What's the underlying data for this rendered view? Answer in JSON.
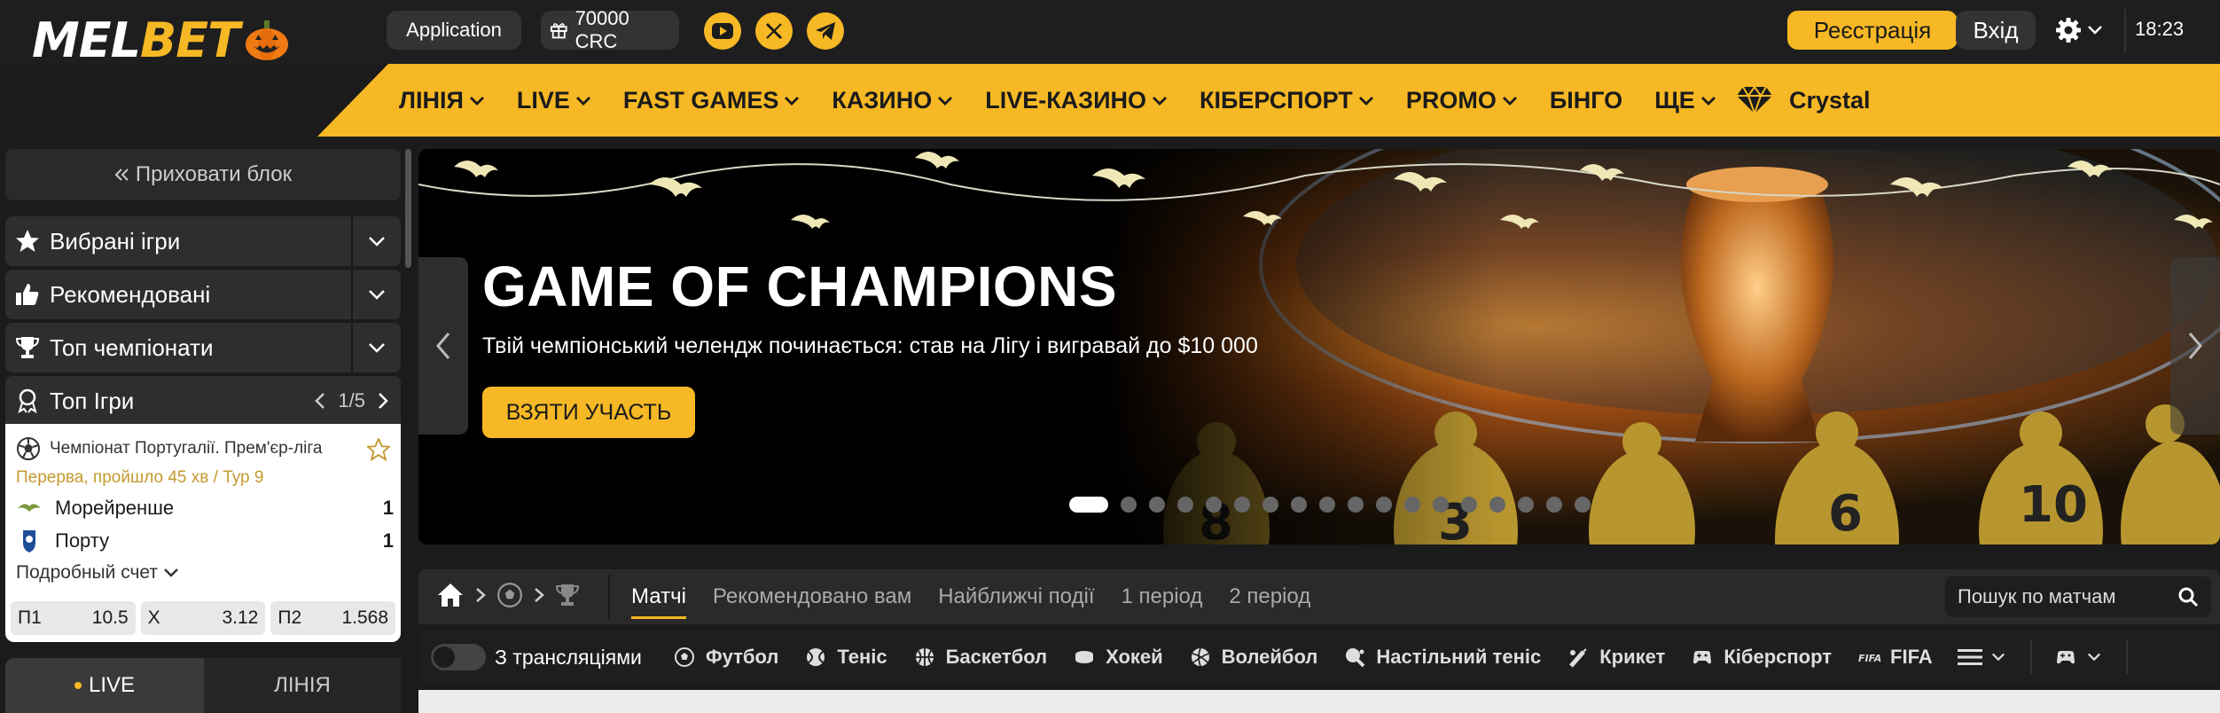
{
  "header": {
    "logo": {
      "part1": "MEL",
      "part2": "BET"
    },
    "application_label": "Application",
    "bonus_label": "70000 CRC",
    "register_label": "Реєстрація",
    "login_label": "Вхід",
    "time": "18:23"
  },
  "nav": {
    "items": [
      {
        "label": "ЛІНІЯ",
        "dropdown": true
      },
      {
        "label": "LIVE",
        "dropdown": true
      },
      {
        "label": "FAST GAMES",
        "dropdown": true
      },
      {
        "label": "КАЗИНО",
        "dropdown": true
      },
      {
        "label": "LIVE-КАЗИНО",
        "dropdown": true
      },
      {
        "label": "КІБЕРСПОРТ",
        "dropdown": true
      },
      {
        "label": "PROMO",
        "dropdown": true
      },
      {
        "label": "БІНГО",
        "dropdown": false
      },
      {
        "label": "ЩЕ",
        "dropdown": true
      }
    ],
    "crystal_label": "Crystal"
  },
  "sidebar": {
    "hide_block_label": "Приховати блок",
    "sections": [
      {
        "label": "Вибрані ігри",
        "icon": "star-icon"
      },
      {
        "label": "Рекомендовані",
        "icon": "thumbs-up-icon"
      },
      {
        "label": "Топ чемпіонати",
        "icon": "trophy-icon"
      }
    ],
    "top_games": {
      "label": "Топ Ігри",
      "page": "1/5"
    },
    "match": {
      "league": "Чемпіонат Португалії. Прем'єр-ліга",
      "status": "Перерва, пройшло 45 хв / Тур 9",
      "team1": {
        "name": "Морейренше",
        "score": "1"
      },
      "team2": {
        "name": "Порту",
        "score": "1"
      },
      "details_label": "Подробный счет",
      "odds": [
        {
          "label": "П1",
          "value": "10.5"
        },
        {
          "label": "X",
          "value": "3.12"
        },
        {
          "label": "П2",
          "value": "1.568"
        }
      ]
    },
    "tabs": {
      "live": "LIVE",
      "line": "ЛІНІЯ"
    }
  },
  "banner": {
    "title": "GAME OF CHAMPIONS",
    "subtitle": "Твій чемпіонський челендж починається: став на Лігу і вигравай до $10 000",
    "cta": "ВЗЯТИ УЧАСТЬ",
    "slide_count": 18,
    "active_slide": 1
  },
  "filters": {
    "tabs": [
      {
        "label": "Матчі",
        "active": true
      },
      {
        "label": "Рекомендовано вам",
        "active": false
      },
      {
        "label": "Найближчі події",
        "active": false
      },
      {
        "label": "1 період",
        "active": false
      },
      {
        "label": "2 період",
        "active": false
      }
    ],
    "search_placeholder": "Пошук по матчам"
  },
  "sports": {
    "toggle_label": "З трансляціями",
    "items": [
      {
        "label": "Футбол",
        "icon": "football-icon"
      },
      {
        "label": "Теніс",
        "icon": "tennis-icon"
      },
      {
        "label": "Баскетбол",
        "icon": "basketball-icon"
      },
      {
        "label": "Хокей",
        "icon": "hockey-icon"
      },
      {
        "label": "Волейбол",
        "icon": "volleyball-icon"
      },
      {
        "label": "Настільний теніс",
        "icon": "table-tennis-icon"
      },
      {
        "label": "Крикет",
        "icon": "cricket-icon"
      },
      {
        "label": "Кіберспорт",
        "icon": "gamepad-icon"
      },
      {
        "label": "FIFA",
        "icon": "fifa-icon"
      }
    ]
  },
  "colors": {
    "accent": "#f6b824",
    "background": "#1b1b1b",
    "panel": "#2e2e2e"
  }
}
